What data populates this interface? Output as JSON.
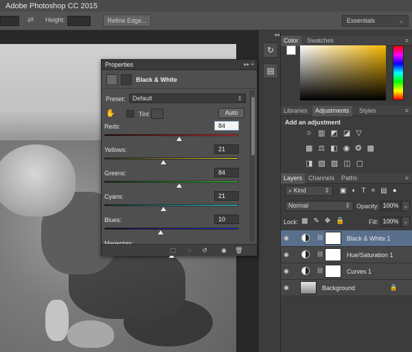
{
  "app": {
    "title": "Adobe Photoshop CC 2015"
  },
  "options_bar": {
    "height_label": "Height:",
    "refine_edge": "Refine Edge...",
    "workspace": "Essentials"
  },
  "properties": {
    "panel_title": "Properties",
    "adjustment_name": "Black & White",
    "preset_label": "Preset:",
    "preset_value": "Default",
    "tint_label": "Tint",
    "auto_label": "Auto",
    "sliders": [
      {
        "name": "Reds:",
        "value": "84",
        "fraction": 0.56,
        "gradient": "linear-gradient(90deg,#2a0000,#ff2a2a)"
      },
      {
        "name": "Yellows:",
        "value": "21",
        "fraction": 0.44,
        "gradient": "linear-gradient(90deg,#2a2a00,#fff02a)"
      },
      {
        "name": "Greens:",
        "value": "84",
        "fraction": 0.56,
        "gradient": "linear-gradient(90deg,#002a00,#2aff2a)"
      },
      {
        "name": "Cyans:",
        "value": "21",
        "fraction": 0.44,
        "gradient": "linear-gradient(90deg,#002a2a,#2affff)"
      },
      {
        "name": "Blues:",
        "value": "10",
        "fraction": 0.42,
        "gradient": "linear-gradient(90deg,#00002a,#2a2aff)"
      },
      {
        "name": "Magentas:",
        "value": "",
        "fraction": 0.5,
        "gradient": "linear-gradient(90deg,#2a002a,#ff2aff)"
      }
    ]
  },
  "color_panel": {
    "tabs": [
      "Color",
      "Swatches"
    ],
    "active": "Color"
  },
  "adjustments_panel": {
    "tabs": [
      "Libraries",
      "Adjustments",
      "Styles"
    ],
    "active": "Adjustments",
    "heading": "Add an adjustment"
  },
  "layers_panel": {
    "tabs": [
      "Layers",
      "Channels",
      "Paths"
    ],
    "active": "Layers",
    "filter_kind": "Kind",
    "blend_mode": "Normal",
    "opacity_label": "Opacity:",
    "opacity_value": "100%",
    "lock_label": "Lock:",
    "fill_label": "Fill:",
    "fill_value": "100%",
    "layers": [
      {
        "name": "Black & White 1",
        "selected": true,
        "type": "adjustment"
      },
      {
        "name": "Hue/Saturation 1",
        "selected": false,
        "type": "adjustment"
      },
      {
        "name": "Curves 1",
        "selected": false,
        "type": "adjustment"
      },
      {
        "name": "Background",
        "selected": false,
        "type": "image",
        "locked": true
      }
    ]
  },
  "colors": {
    "accent": "#5a6f8c",
    "panel": "#3c3c3c",
    "header": "#434343"
  },
  "icons": [
    "swap-arrows-icon",
    "eye-icon",
    "chain-icon",
    "lock-icon",
    "hand-icon",
    "trash-icon",
    "undo-icon",
    "visibility-icon"
  ]
}
